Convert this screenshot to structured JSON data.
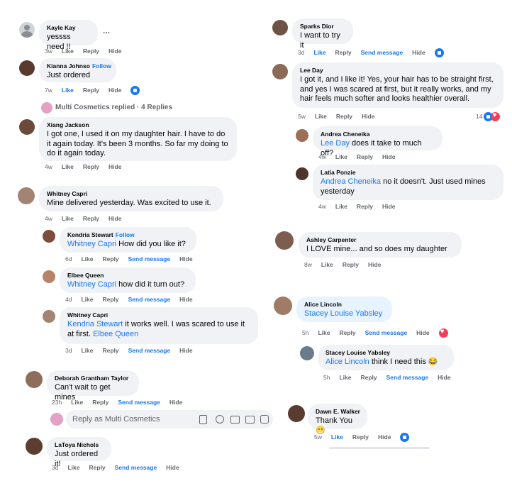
{
  "left": {
    "c1": {
      "name": "Kayle Kay",
      "text": "yessss need !!",
      "ago": "3w",
      "like": "Like",
      "reply": "Reply",
      "hide": "Hide",
      "more": "..."
    },
    "c2": {
      "name": "Kianna Johnso",
      "follow": "Follow",
      "text": "Just ordered",
      "ago": "7w",
      "like": "Like",
      "reply": "Reply",
      "hide": "Hide"
    },
    "replied": {
      "brand": "Multi Cosmetics",
      "text": "Multi Cosmetics replied · 4 Replies"
    },
    "c3": {
      "name": "Xiang Jackson",
      "text": "I got one, I used it on my daughter hair. I have to do it again today. It's been 3 months. So far my doing to do it again today.",
      "ago": "4w",
      "like": "Like",
      "reply": "Reply",
      "hide": "Hide"
    },
    "c4": {
      "name": "Whitney Capri",
      "text": "Mine delivered yesterday. Was excited to use it.",
      "ago": "4w",
      "like": "Like",
      "reply": "Reply",
      "hide": "Hide"
    },
    "r1": {
      "name": "Kendria Stewart",
      "follow": "Follow",
      "mention": "Whitney Capri",
      "text": " How did you like it?",
      "ago": "6d",
      "like": "Like",
      "reply": "Reply",
      "send": "Send message",
      "hide": "Hide"
    },
    "r2": {
      "name": "Elbee Queen",
      "mention": "Whitney Capri",
      "text": " how did it turn out?",
      "ago": "4d",
      "like": "Like",
      "reply": "Reply",
      "send": "Send message",
      "hide": "Hide"
    },
    "r3": {
      "name": "Whitney Capri",
      "mention": "Kendria Stewart",
      "text": " it works well. I was scared to use it at first. ",
      "mention2": "Elbee Queen",
      "ago": "3d",
      "like": "Like",
      "reply": "Reply",
      "send": "Send message",
      "hide": "Hide"
    },
    "c5": {
      "name": "Deborah Grantham Taylor",
      "text": "Can't wait to get mines",
      "ago": "23h",
      "like": "Like",
      "reply": "Reply",
      "send": "Send message",
      "hide": "Hide"
    },
    "replybox": {
      "placeholder": "Reply as Multi Cosmetics"
    },
    "c6": {
      "name": "LaToya Nichols",
      "text": "Just ordered it!",
      "ago": "3d",
      "like": "Like",
      "reply": "Reply",
      "send": "Send message",
      "hide": "Hide"
    }
  },
  "right": {
    "c1": {
      "name": "Sparks Dior",
      "text": "I want to try it",
      "ago": "3d",
      "like": "Like",
      "reply": "Reply",
      "send": "Send message",
      "hide": "Hide"
    },
    "c2": {
      "name": "Lee Day",
      "text": "I got it, and I like it! Yes, your hair has to be straight first, and yes I was scared at first, but it really works, and my hair feels much softer and looks healthier overall.",
      "ago": "5w",
      "like": "Like",
      "reply": "Reply",
      "hide": "Hide",
      "count": "14"
    },
    "r1": {
      "name": "Andrea Cheneika",
      "mention": "Lee Day",
      "text": " does it take to much off?",
      "ago": "4w",
      "like": "Like",
      "reply": "Reply",
      "hide": "Hide"
    },
    "r2": {
      "name": "Latia Ponzie",
      "mention": "Andrea Cheneika",
      "text": " no it doesn't. Just used mines yesterday",
      "ago": "4w",
      "like": "Like",
      "reply": "Reply",
      "hide": "Hide"
    },
    "c3": {
      "name": "Ashley Carpenter",
      "text": "I LOVE mine... and so does my daughter",
      "ago": "8w",
      "like": "Like",
      "reply": "Reply",
      "hide": "Hide"
    },
    "c4": {
      "name": "Alice Lincoln",
      "mention": "Stacey Louise Yabsley",
      "ago": "5h",
      "like": "Like",
      "reply": "Reply",
      "send": "Send message",
      "hide": "Hide"
    },
    "r3": {
      "name": "Stacey Louise Yabsley",
      "mention": "Alice Lincoln",
      "text": " think I need this 😂",
      "ago": "5h",
      "like": "Like",
      "reply": "Reply",
      "send": "Send message",
      "hide": "Hide"
    },
    "c5": {
      "name": "Dawn E. Walker",
      "text": "Thank You 😁",
      "ago": "5w",
      "like": "Like",
      "reply": "Reply",
      "hide": "Hide"
    }
  },
  "colors": {
    "accent": "#1877f2",
    "bubble": "#f0f2f5",
    "love": "#f33e58",
    "muted": "#65676b"
  }
}
